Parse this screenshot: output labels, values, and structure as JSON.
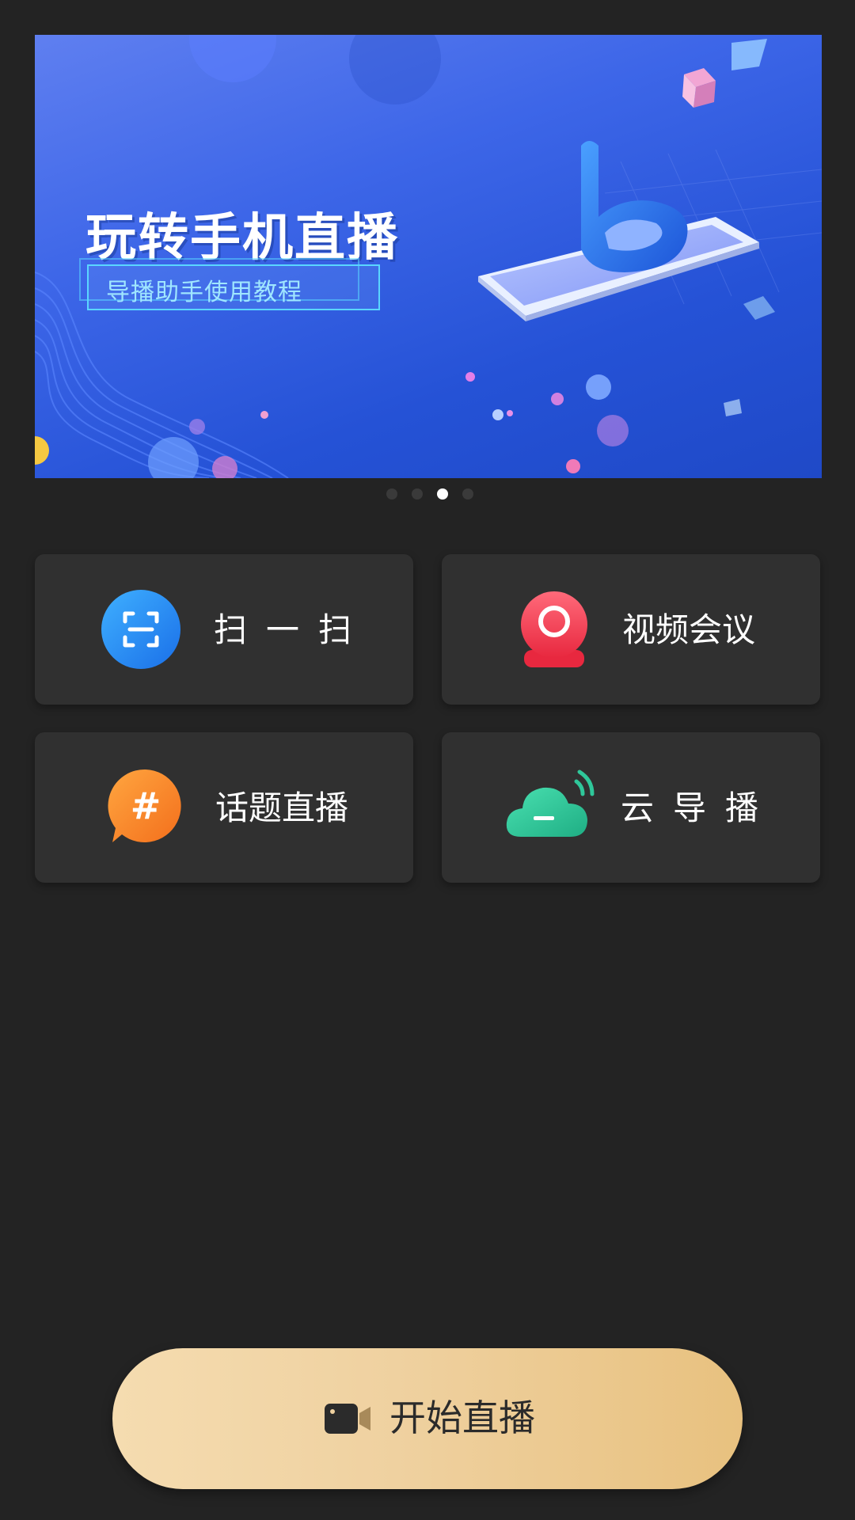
{
  "banner": {
    "title": "玩转手机直播",
    "subtitle": "导播助手使用教程",
    "logo_letter": "b",
    "carousel_dots": 4,
    "active_index": 2
  },
  "tiles": [
    {
      "label": "扫一扫",
      "icon": "scan-icon",
      "color": "#1e8ef0"
    },
    {
      "label": "视频会议",
      "icon": "webcam-icon",
      "color": "#f0404e"
    },
    {
      "label": "话题直播",
      "icon": "hashtag-chat-icon",
      "color": "#f5892a"
    },
    {
      "label": "云导播",
      "icon": "cloud-signal-icon",
      "color": "#2fc79a"
    }
  ],
  "start_button": {
    "label": "开始直播",
    "icon": "video-camera-icon"
  },
  "colors": {
    "background": "#232323",
    "tile": "#303030",
    "button_gradient_start": "#f5dcb0",
    "button_gradient_end": "#e8c17f"
  }
}
